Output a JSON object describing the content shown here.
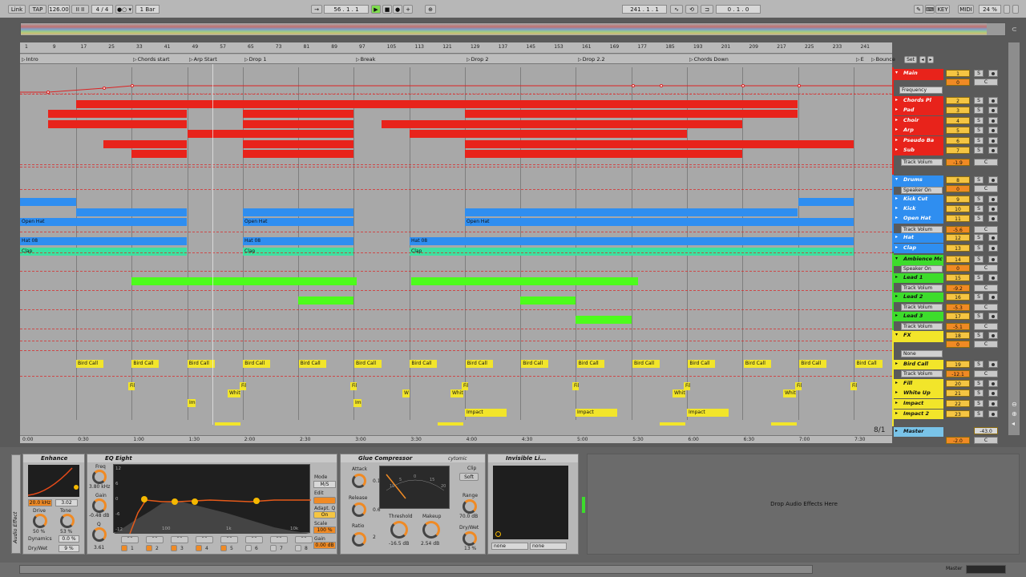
{
  "toolbar": {
    "link": "Link",
    "tap": "TAP",
    "tempo": "126.00",
    "meter": "4 / 4",
    "quant": "1 Bar",
    "position": "56 .  1 .  1",
    "loop_start": "241 .  1 .  1",
    "loop_length": "0 .  1 .  0",
    "key": "KEY",
    "midi": "MIDI",
    "cpu": "24 %"
  },
  "ruler": {
    "bars": [
      "1",
      "9",
      "17",
      "25",
      "33",
      "41",
      "49",
      "57",
      "65",
      "73",
      "81",
      "89",
      "97",
      "105",
      "113",
      "121",
      "129",
      "137",
      "145",
      "153",
      "161",
      "169",
      "177",
      "185",
      "193",
      "201",
      "209",
      "217",
      "225",
      "233",
      "241"
    ],
    "times": [
      "0:00",
      "0:30",
      "1:00",
      "1:30",
      "2:00",
      "2:30",
      "3:00",
      "3:30",
      "4:00",
      "4:30",
      "5:00",
      "5:30",
      "6:00",
      "6:30",
      "7:00",
      "7:30"
    ],
    "signature": "8/1"
  },
  "locators": [
    "Intro",
    "Chords start",
    "Arp Start",
    "Drop 1",
    "Break",
    "Drop 2",
    "Drop 2.2",
    "Chords Down",
    "E",
    "Bounce"
  ],
  "set_button": "Set",
  "tracks": [
    {
      "name": "Main",
      "num": "1",
      "vol": "0",
      "kind": "group",
      "color": "#e8231b"
    },
    {
      "name": "Frequency",
      "kind": "chooser"
    },
    {
      "name": "Chords Pl",
      "num": "2",
      "color": "#e8231b"
    },
    {
      "name": "Pad",
      "num": "3",
      "color": "#e8231b"
    },
    {
      "name": "Choir",
      "num": "4",
      "color": "#e8231b"
    },
    {
      "name": "Arp",
      "num": "5",
      "color": "#e8231b"
    },
    {
      "name": "Pseudo Ba",
      "num": "6",
      "color": "#e8231b"
    },
    {
      "name": "Sub",
      "num": "7",
      "color": "#e8231b"
    },
    {
      "name": "Drums",
      "num": "8",
      "vol": "0",
      "kind": "group",
      "color": "#2f8ef0"
    },
    {
      "name": "Kick Cut",
      "num": "9",
      "color": "#2f8ef0"
    },
    {
      "name": "Kick",
      "num": "10",
      "color": "#2f8ef0"
    },
    {
      "name": "Open Hat",
      "num": "11",
      "color": "#2f8ef0"
    },
    {
      "name": "Hat",
      "num": "12",
      "color": "#2f8ef0"
    },
    {
      "name": "Clap",
      "num": "13",
      "color": "#2f8ef0"
    },
    {
      "name": "Ambience Mc",
      "num": "14",
      "vol": "0",
      "kind": "group",
      "color": "#3ddc2c"
    },
    {
      "name": "Lead 1",
      "num": "15",
      "color": "#3ddc2c"
    },
    {
      "name": "Lead 2",
      "num": "16",
      "color": "#3ddc2c"
    },
    {
      "name": "Lead 3",
      "num": "17",
      "color": "#3ddc2c"
    },
    {
      "name": "FX",
      "num": "18",
      "vol": "0",
      "kind": "group",
      "color": "#f2e52a"
    },
    {
      "name": "Bird Call",
      "num": "19",
      "color": "#f2e52a"
    },
    {
      "name": "Fill",
      "num": "20",
      "color": "#f2e52a"
    },
    {
      "name": "White Up",
      "num": "21",
      "color": "#f2e52a"
    },
    {
      "name": "Impact",
      "num": "22",
      "color": "#f2e52a"
    },
    {
      "name": "Impact 2",
      "num": "23",
      "color": "#f2e52a"
    },
    {
      "name": "Master",
      "vol": "-2.0",
      "vol2": "-43.0",
      "kind": "master",
      "color": "#79c3e8"
    }
  ],
  "choosers": {
    "track_volume": "Track Volum",
    "speaker_on": "Speaker On",
    "none": "None",
    "vol_vals": [
      "-1.9",
      "-5.6",
      "-9.2",
      "-5.3",
      "-5.1",
      "-12.1"
    ]
  },
  "clip_labels": {
    "open_hat": "Open Hat",
    "hat": "Hat 08",
    "clap": "Clap",
    "bird": "Bird Call",
    "impact": "Impact",
    "fill": "Fil",
    "white": "Whit",
    "imp": "Imp",
    "w": "W"
  },
  "devices": {
    "enhance": {
      "title": "Enhance",
      "freq": "20.0 kHz",
      "val2": "3.02",
      "drive": "Drive",
      "drive_val": "50 %",
      "tone": "Tone",
      "tone_val": "53 %",
      "dyn": "Dynamics",
      "dyn_val": "0.0 %",
      "drywet": "Dry/Wet",
      "drywet_val": "9 %"
    },
    "eq": {
      "title": "EQ Eight",
      "freq": "Freq",
      "freq_val": "3.80 kHz",
      "gain": "Gain",
      "gain_val": "-0.48 dB",
      "q": "Q",
      "q_val": "3.61",
      "mode": "Mode",
      "mode_val": "M/S",
      "edit": "Edit",
      "adapt": "Adapt. Q",
      "on": "On",
      "scale": "Scale",
      "scale_val": "100 %",
      "gain2": "Gain",
      "gain2_val": "0.00 dB",
      "db_labels": [
        "12",
        "6",
        "0",
        "-6",
        "-12"
      ],
      "freq_labels": [
        "100",
        "1k",
        "10k"
      ]
    },
    "glue": {
      "title": "Glue Compressor",
      "brand": "cytomic",
      "attack": "Attack",
      "attack_val": "0.1",
      "release": "Release",
      "release_val": "0.6",
      "ratio": "Ratio",
      "ratio_val": "2",
      "clip": "Clip",
      "soft": "Soft",
      "threshold": "Threshold",
      "threshold_val": "-16.5 dB",
      "makeup": "Makeup",
      "makeup_val": "2.54 dB",
      "range": "Range",
      "range_val": "70.0 dB",
      "drywet": "Dry/Wet",
      "drywet_val": "13 %",
      "meter_labels": [
        "10",
        "5",
        "0",
        "15",
        "20"
      ]
    },
    "invisible": {
      "title": "Invisible Li...",
      "none1": "none",
      "none2": "none"
    },
    "drop_hint": "Drop Audio Effects Here",
    "side": "Audio Effect"
  },
  "status": {
    "master": "Master"
  }
}
